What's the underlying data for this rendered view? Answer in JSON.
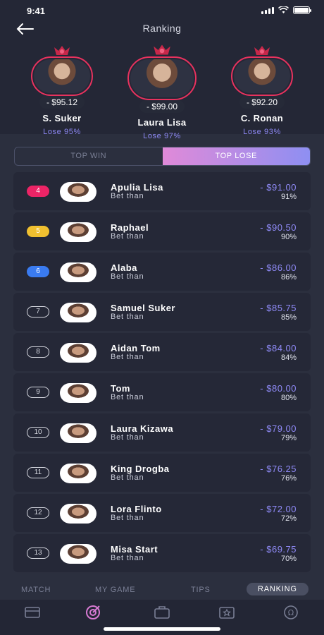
{
  "status": {
    "time": "9:41"
  },
  "header": {
    "title": "Ranking"
  },
  "podium": [
    {
      "amount": "- $95.12",
      "name": "S. Suker",
      "lose": "Lose 95%"
    },
    {
      "amount": "- $99.00",
      "name": "Laura Lisa",
      "lose": "Lose 97%"
    },
    {
      "amount": "- $92.20",
      "name": "C. Ronan",
      "lose": "Lose 93%"
    }
  ],
  "tabs": {
    "win": "TOP WIN",
    "lose": "TOP LOSE"
  },
  "rows": [
    {
      "rank": "4",
      "name": "Apulia Lisa",
      "sub": "Bet than",
      "amount": "- $91.00",
      "pct": "91%"
    },
    {
      "rank": "5",
      "name": "Raphael",
      "sub": "Bet than",
      "amount": "- $90.50",
      "pct": "90%"
    },
    {
      "rank": "6",
      "name": "Alaba",
      "sub": "Bet than",
      "amount": "- $86.00",
      "pct": "86%"
    },
    {
      "rank": "7",
      "name": "Samuel Suker",
      "sub": "Bet than",
      "amount": "- $85.75",
      "pct": "85%"
    },
    {
      "rank": "8",
      "name": "Aidan Tom",
      "sub": "Bet than",
      "amount": "- $84.00",
      "pct": "84%"
    },
    {
      "rank": "9",
      "name": "Tom",
      "sub": "Bet than",
      "amount": "- $80.00",
      "pct": "80%"
    },
    {
      "rank": "10",
      "name": "Laura Kizawa",
      "sub": "Bet than",
      "amount": "- $79.00",
      "pct": "79%"
    },
    {
      "rank": "11",
      "name": "King Drogba",
      "sub": "Bet than",
      "amount": "- $76.25",
      "pct": "76%"
    },
    {
      "rank": "12",
      "name": "Lora Flinto",
      "sub": "Bet than",
      "amount": "- $72.00",
      "pct": "72%"
    },
    {
      "rank": "13",
      "name": "Misa Start",
      "sub": "Bet than",
      "amount": "- $69.75",
      "pct": "70%"
    }
  ],
  "bottom_tabs": {
    "match": "MATCH",
    "my_game": "MY GAME",
    "tips": "TIPS",
    "ranking": "RANKING"
  },
  "nav_icons": [
    "card-icon",
    "target-icon",
    "briefcase-icon",
    "star-tray-icon",
    "omega-icon"
  ],
  "colors": {
    "accent": "#8f8af6",
    "red": "#ec2466",
    "gold": "#f0c030",
    "blue": "#3a7bf0"
  }
}
